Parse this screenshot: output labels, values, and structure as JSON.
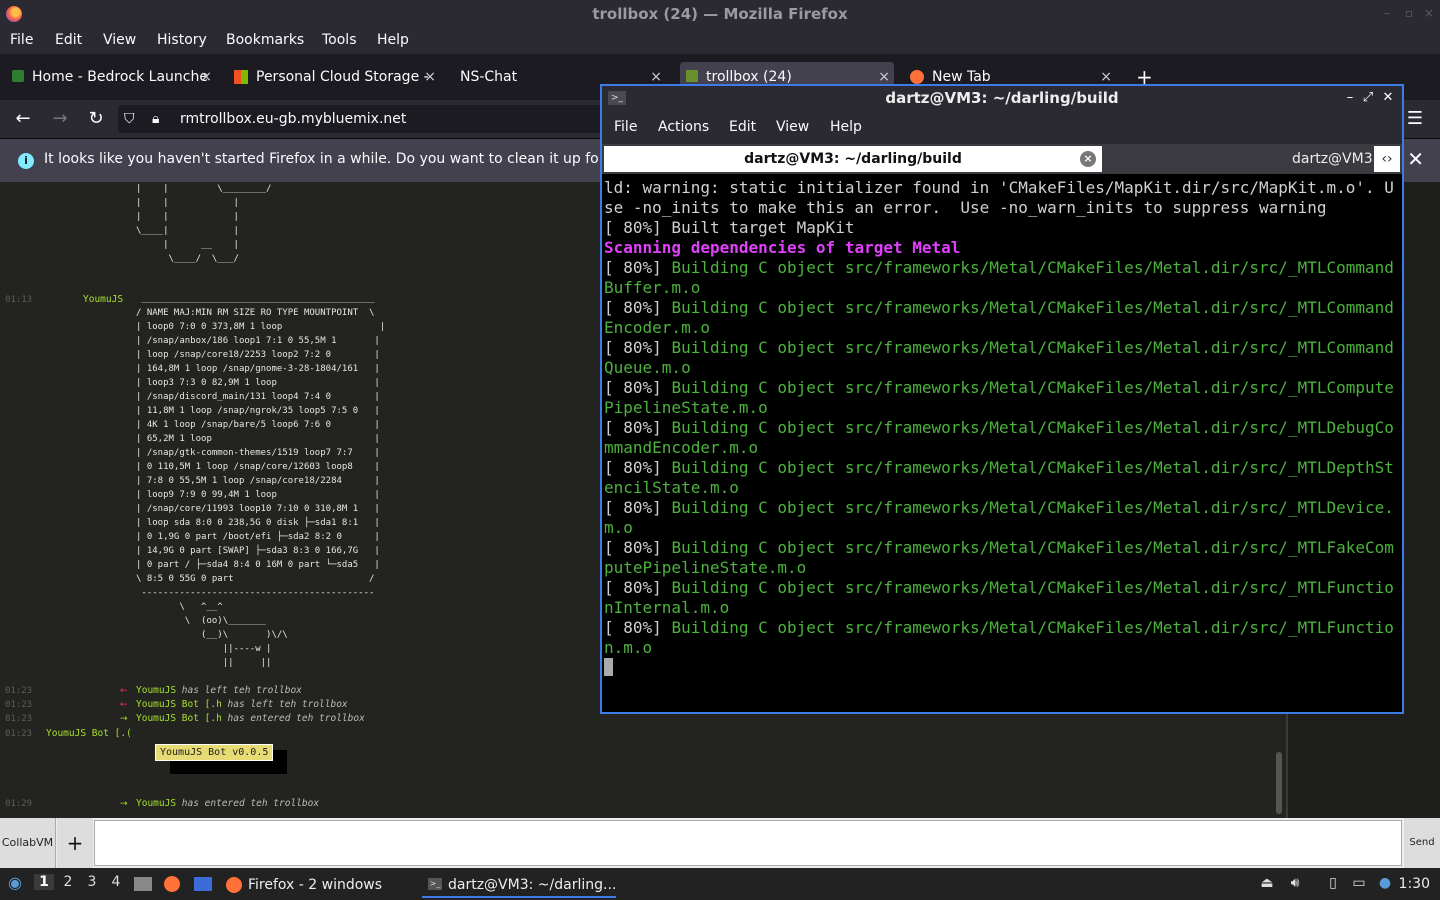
{
  "firefox": {
    "title": "trollbox (24) — Mozilla Firefox",
    "menu": [
      "File",
      "Edit",
      "View",
      "History",
      "Bookmarks",
      "Tools",
      "Help"
    ],
    "tabs": [
      {
        "label": "Home - Bedrock Launche"
      },
      {
        "label": "Personal Cloud Storage -"
      },
      {
        "label": "NS-Chat"
      },
      {
        "label": "trollbox (24)"
      },
      {
        "label": "New Tab"
      }
    ],
    "url": "rmtrollbox.eu-gb.mybluemix.net",
    "notification": "It looks like you haven't started Firefox in a while. Do you want to clean it up for a f"
  },
  "trollbox": {
    "ascii_top": "|    |         \\________/\n|    |            |\n|    |            |\n\\____|            |\n     |      __    |\n      \\____/  \\___/",
    "msg1": {
      "time": "01:13",
      "nick": "YoumuJS"
    },
    "table": " ___________________________________________\n/ NAME MAJ:MIN RM SIZE RO TYPE MOUNTPOINT  \\\n| loop0 7:0 0 373,8M 1 loop                  |\n| /snap/anbox/186 loop1 7:1 0 55,5M 1       |\n| loop /snap/core18/2253 loop2 7:2 0        |\n| 164,8M 1 loop /snap/gnome-3-28-1804/161   |\n| loop3 7:3 0 82,9M 1 loop                  |\n| /snap/discord_main/131 loop4 7:4 0        |\n| 11,8M 1 loop /snap/ngrok/35 loop5 7:5 0   |\n| 4K 1 loop /snap/bare/5 loop6 7:6 0        |\n| 65,2M 1 loop                              |\n| /snap/gtk-common-themes/1519 loop7 7:7    |\n| 0 110,5M 1 loop /snap/core/12603 loop8    |\n| 7:8 0 55,5M 1 loop /snap/core18/2284      |\n| loop9 7:9 0 99,4M 1 loop                  |\n| /snap/core/11993 loop10 7:10 0 310,8M 1   |\n| loop sda 8:0 0 238,5G 0 disk ├─sda1 8:1   |\n| 0 1,9G 0 part /boot/efi ├─sda2 8:2 0      |\n| 14,9G 0 part [SWAP] ├─sda3 8:3 0 166,7G   |\n| 0 part / ├─sda4 8:4 0 16M 0 part └─sda5   |\n\\ 8:5 0 55G 0 part                         /\n -------------------------------------------",
    "cow": "        \\   ^__^\n         \\  (oo)\\_______\n            (__)\\       )\\/\\\n                ||----w |\n                ||     ||",
    "events": [
      {
        "time": "01:23",
        "dir": "left",
        "nick": "YoumuJS",
        "text": "has left teh trollbox"
      },
      {
        "time": "01:23",
        "dir": "left",
        "nick": "YoumuJS Bot [.h",
        "text": "has left teh trollbox"
      },
      {
        "time": "01:23",
        "dir": "enter",
        "nick": "YoumuJS Bot [.h",
        "text": "has entered teh trollbox"
      }
    ],
    "msg2": {
      "time": "01:23",
      "nick": "YoumuJS Bot [.("
    },
    "bot_badge": "YoumuJS Bot v0.0.5",
    "last_event": {
      "time": "01:29",
      "nick": "YoumuJS",
      "text": "has entered teh trollbox"
    }
  },
  "inputbar": {
    "room": "CollabVM",
    "add": "+",
    "send": "Send"
  },
  "terminal": {
    "title": "dartz@VM3: ~/darling/build",
    "menu": [
      "File",
      "Actions",
      "Edit",
      "View",
      "Help"
    ],
    "tab_active": "dartz@VM3: ~/darling/build",
    "tab_other": "dartz@VM3",
    "warning": "ld: warning: static initializer found in 'CMakeFiles/MapKit.dir/src/MapKit.m.o'. Use -no_inits to make this an error.  Use -no_warn_inits to suppress warning",
    "built": "[ 80%] Built target MapKit",
    "scanning": "Scanning dependencies of target Metal",
    "prefix": "[ 80%] ",
    "building": [
      "Building C object src/frameworks/Metal/CMakeFiles/Metal.dir/src/_MTLCommandBuffer.m.o",
      "Building C object src/frameworks/Metal/CMakeFiles/Metal.dir/src/_MTLCommandEncoder.m.o",
      "Building C object src/frameworks/Metal/CMakeFiles/Metal.dir/src/_MTLCommandQueue.m.o",
      "Building C object src/frameworks/Metal/CMakeFiles/Metal.dir/src/_MTLComputePipelineState.m.o",
      "Building C object src/frameworks/Metal/CMakeFiles/Metal.dir/src/_MTLDebugCommandEncoder.m.o",
      "Building C object src/frameworks/Metal/CMakeFiles/Metal.dir/src/_MTLDepthStencilState.m.o",
      "Building C object src/frameworks/Metal/CMakeFiles/Metal.dir/src/_MTLDevice.m.o",
      "Building C object src/frameworks/Metal/CMakeFiles/Metal.dir/src/_MTLFakeComputePipelineState.m.o",
      "Building C object src/frameworks/Metal/CMakeFiles/Metal.dir/src/_MTLFunctionInternal.m.o",
      "Building C object src/frameworks/Metal/CMakeFiles/Metal.dir/src/_MTLFunction.m.o"
    ]
  },
  "taskbar": {
    "workspaces": [
      "1",
      "2",
      "3",
      "4"
    ],
    "firefox_task": "Firefox - 2 windows",
    "terminal_task": "dartz@VM3: ~/darling...",
    "clock": "1:30"
  }
}
